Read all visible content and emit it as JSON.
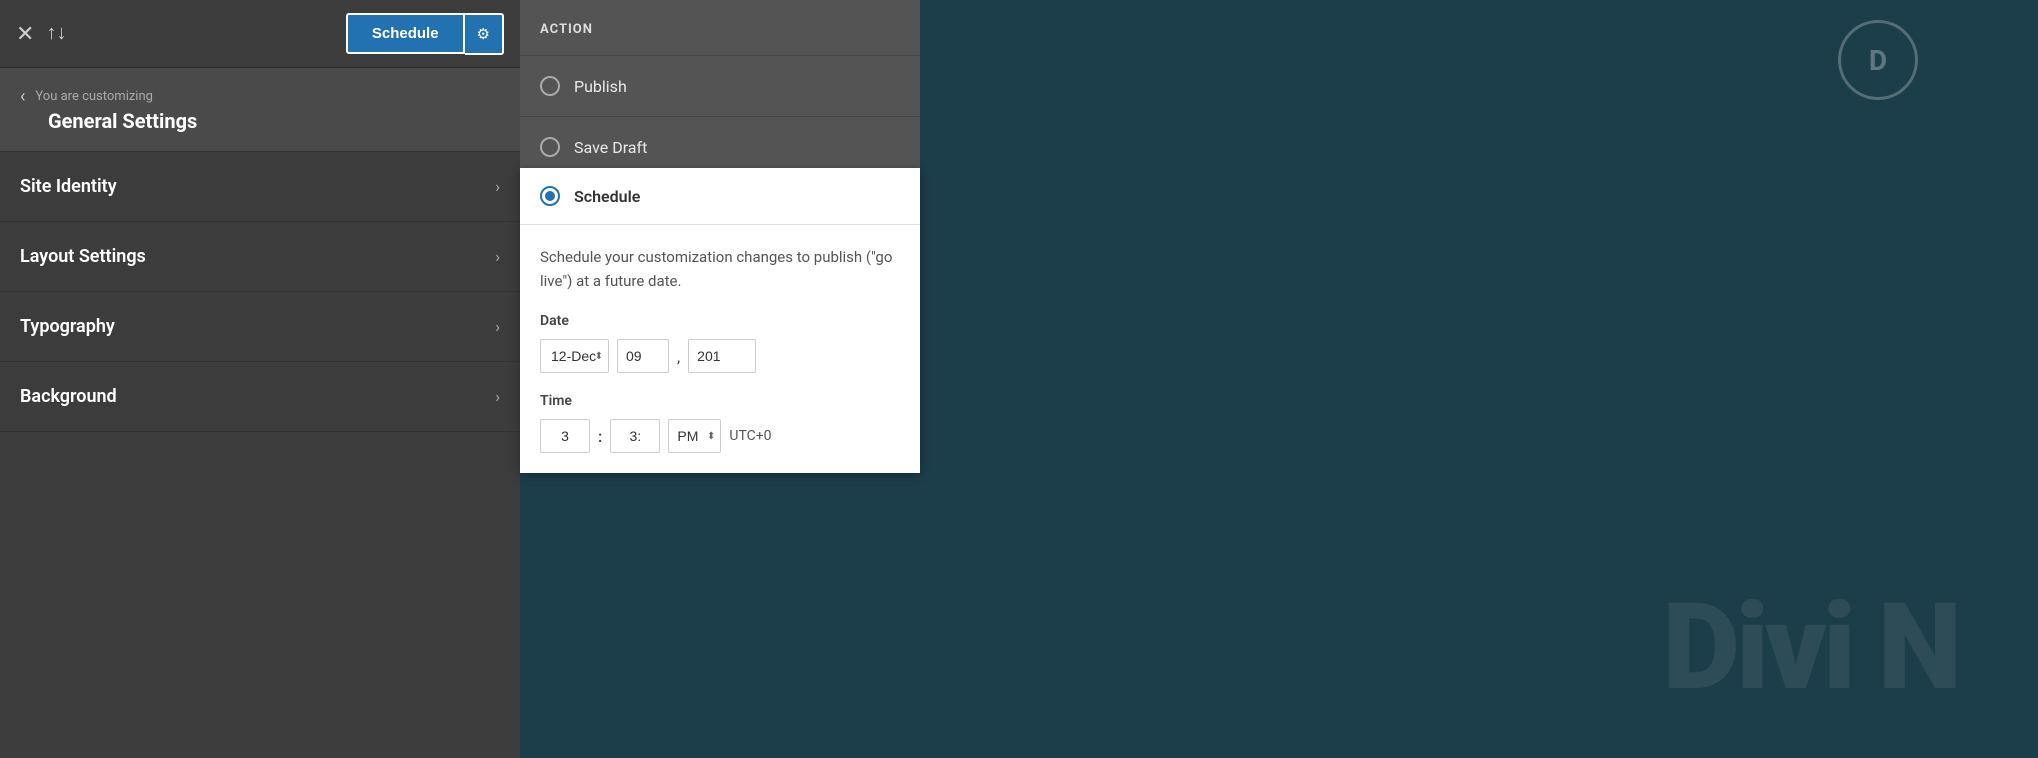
{
  "topBar": {
    "scheduleLabel": "Schedule",
    "gearIcon": "⚙"
  },
  "breadcrumb": {
    "customizingLabel": "You are customizing",
    "pageTitle": "General Settings",
    "backIcon": "‹"
  },
  "navItems": [
    {
      "label": "Site Identity",
      "chevron": "›"
    },
    {
      "label": "Layout Settings",
      "chevron": "›"
    },
    {
      "label": "Typography",
      "chevron": "›"
    },
    {
      "label": "Background",
      "chevron": "›"
    }
  ],
  "actionPanel": {
    "title": "ACTION",
    "options": [
      {
        "label": "Publish",
        "selected": false
      },
      {
        "label": "Save Draft",
        "selected": false
      },
      {
        "label": "Schedule",
        "selected": true
      }
    ]
  },
  "schedulePanel": {
    "title": "Schedule",
    "description": "Schedule your customization changes to publish (\"go live\") at a future date.",
    "dateLabel": "Date",
    "dayMonthValue": "12-Dec",
    "dayValue": "09",
    "yearValue": "201",
    "timeLabel": "Time",
    "hourValue": "3",
    "minuteValue": "3:",
    "ampmValue": "PM",
    "utcLabel": "UTC+0"
  },
  "diviLogo": {
    "circleText": "D",
    "bgText": "Divi N"
  },
  "closeIcon": "✕",
  "reorderIcon": "↑↓"
}
